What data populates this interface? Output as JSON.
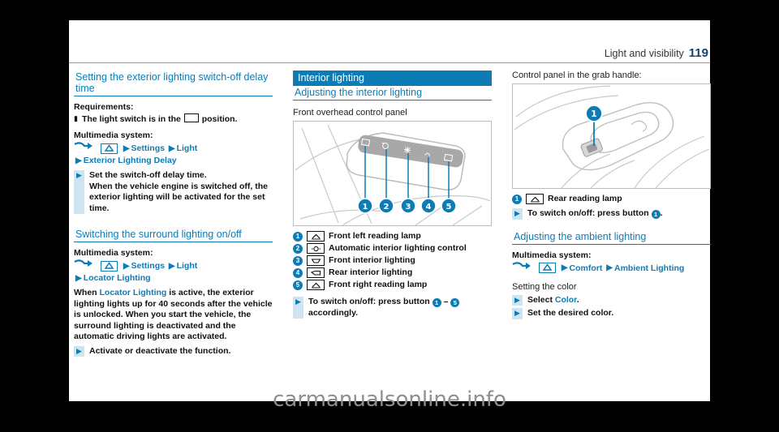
{
  "header": {
    "title": "Light and visibility",
    "page_number": "119"
  },
  "watermark": "carmanualsonline.info",
  "column1": {
    "heading": "Setting the exterior lighting switch-off delay time",
    "requirements_label": "Requirements:",
    "requirement": "The light switch is in the      position.",
    "requirement_pre": "The light switch is in the",
    "requirement_post": "position.",
    "multimedia_label": "Multimedia system:",
    "navpath": [
      "Settings",
      "Light",
      "Exterior Lighting Delay"
    ],
    "step1_title": "Set the switch-off delay time.",
    "step1_body": "When the vehicle engine is switched off, the exterior lighting will be activated for the set time.",
    "heading2": "Switching the surround lighting on/off",
    "multimedia_label2": "Multimedia system:",
    "navpath2": [
      "Settings",
      "Light",
      "Locator Lighting"
    ],
    "body_pre": "When ",
    "body_em": "Locator Lighting",
    "body_post": " is active, the exterior lighting lights up for 40 seconds after the vehicle is unlocked. When you start the vehicle, the surround lighting is deactivated and the automatic driving lights are activated.",
    "step2": "Activate or deactivate the function."
  },
  "column2": {
    "banner": "Interior lighting",
    "heading": "Adjusting the interior lighting",
    "figure_caption": "Front overhead control panel",
    "figure_callouts": [
      "1",
      "2",
      "3",
      "4",
      "5"
    ],
    "legend": [
      {
        "num": "1",
        "icon": "reading-lamp-icon",
        "label": "Front left reading lamp"
      },
      {
        "num": "2",
        "icon": "automatic-interior-lighting-icon",
        "label": "Automatic interior lighting control"
      },
      {
        "num": "3",
        "icon": "front-interior-lighting-icon",
        "label": "Front interior lighting"
      },
      {
        "num": "4",
        "icon": "rear-interior-lighting-icon",
        "label": "Rear interior lighting"
      },
      {
        "num": "5",
        "icon": "reading-lamp-icon",
        "label": "Front right reading lamp"
      }
    ],
    "instruction_pre": "To switch on/off: press button",
    "instruction_range": "–",
    "instruction_post": "accordingly.",
    "instruction_num_from": "1",
    "instruction_num_to": "5"
  },
  "column3": {
    "caption": "Control panel in the grab handle:",
    "figure_callout": "1",
    "legend": [
      {
        "num": "1",
        "icon": "rear-reading-lamp-icon",
        "label": "Rear reading lamp"
      }
    ],
    "instruction_pre": "To switch on/off: press button",
    "instruction_num": "1",
    "instruction_post": ".",
    "heading": "Adjusting the ambient lighting",
    "multimedia_label": "Multimedia system:",
    "navpath": [
      "Comfort",
      "Ambient Lighting"
    ],
    "sub_heading": "Setting the color",
    "step1_pre": "Select ",
    "step1_em": "Color",
    "step1_post": ".",
    "step2": "Set the desired color."
  },
  "colors": {
    "accent": "#0d7cb5",
    "page_number": "#12436b",
    "tri_bg": "#cfe4f2"
  }
}
